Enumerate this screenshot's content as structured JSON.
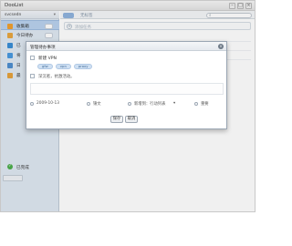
{
  "window": {
    "title": "DooList"
  },
  "sidebar": {
    "user": "svcsedn",
    "items": [
      {
        "label": "收集箱",
        "color": "#f0a030"
      },
      {
        "label": "今日待办",
        "color": "#e8a640"
      },
      {
        "label": "已",
        "color": "#3a8ed6"
      },
      {
        "label": "将",
        "color": "#4a9ae0"
      },
      {
        "label": "日",
        "color": "#4f8fd0"
      },
      {
        "label": "最",
        "color": "#e6a23c"
      }
    ],
    "done_label": "已完成"
  },
  "toolbar": {
    "pill": "全",
    "text": "无标签",
    "search_placeholder": ""
  },
  "content": {
    "add_placeholder": "添加任务"
  },
  "dialog": {
    "title": "管理待办事项",
    "task_title": "新建 VPN",
    "tags": [
      "gfw",
      "vpn",
      "proxy"
    ],
    "subtask": "深沉者，抗激活动。",
    "meta": {
      "date": "2009-10-13",
      "repeat": "锦文",
      "list": "新增到：行动列表",
      "priority": "重要"
    },
    "save_label": "保存",
    "cancel_label": "取消"
  },
  "colors": {
    "accent": "#8fb3de",
    "active_item": "#b9d2ee",
    "done_green": "#4cae4c"
  }
}
